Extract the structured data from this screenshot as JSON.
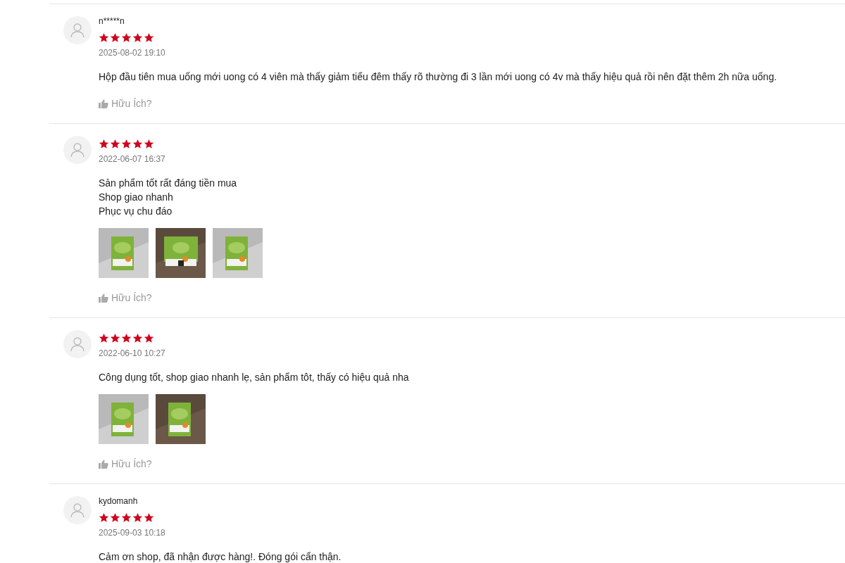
{
  "reviews": [
    {
      "name": "n*****n",
      "stars": 5,
      "date": "2025-08-02 19:10",
      "text": [
        "Hộp đầu tiên mua uống mới uong có 4 viên mà thấy giảm tiểu đêm thấy rõ thường đi 3 lần mới uong có 4v mà thấy hiệu quả rồi nên đặt thêm 2h nữa uống."
      ],
      "helpful": "Hữu Ích?"
    },
    {
      "stars": 5,
      "date": "2022-06-07 16:37",
      "text": [
        "Sản phẩm tốt rất đáng tiền mua",
        "Shop giao nhanh",
        "Phục vụ chu đáo"
      ],
      "photos": [
        {
          "kind": "picture"
        },
        {
          "kind": "picture"
        },
        {
          "kind": "picture"
        }
      ],
      "helpful": "Hữu Ích?"
    },
    {
      "stars": 5,
      "date": "2022-06-10 10:27",
      "text": [
        "Công dụng tốt, shop giao nhanh lẹ, sản phẩm tôt, thấy có hiệu quả nha"
      ],
      "photos": [
        {
          "kind": "picture"
        },
        {
          "kind": "picture"
        }
      ],
      "helpful": "Hữu Ích?"
    },
    {
      "name": "kydomanh",
      "stars": 5,
      "date": "2025-09-03 10:18",
      "text": [
        "Cảm ơn shop, đã nhận được hàng!. Đóng gói cẩn thận."
      ]
    }
  ]
}
